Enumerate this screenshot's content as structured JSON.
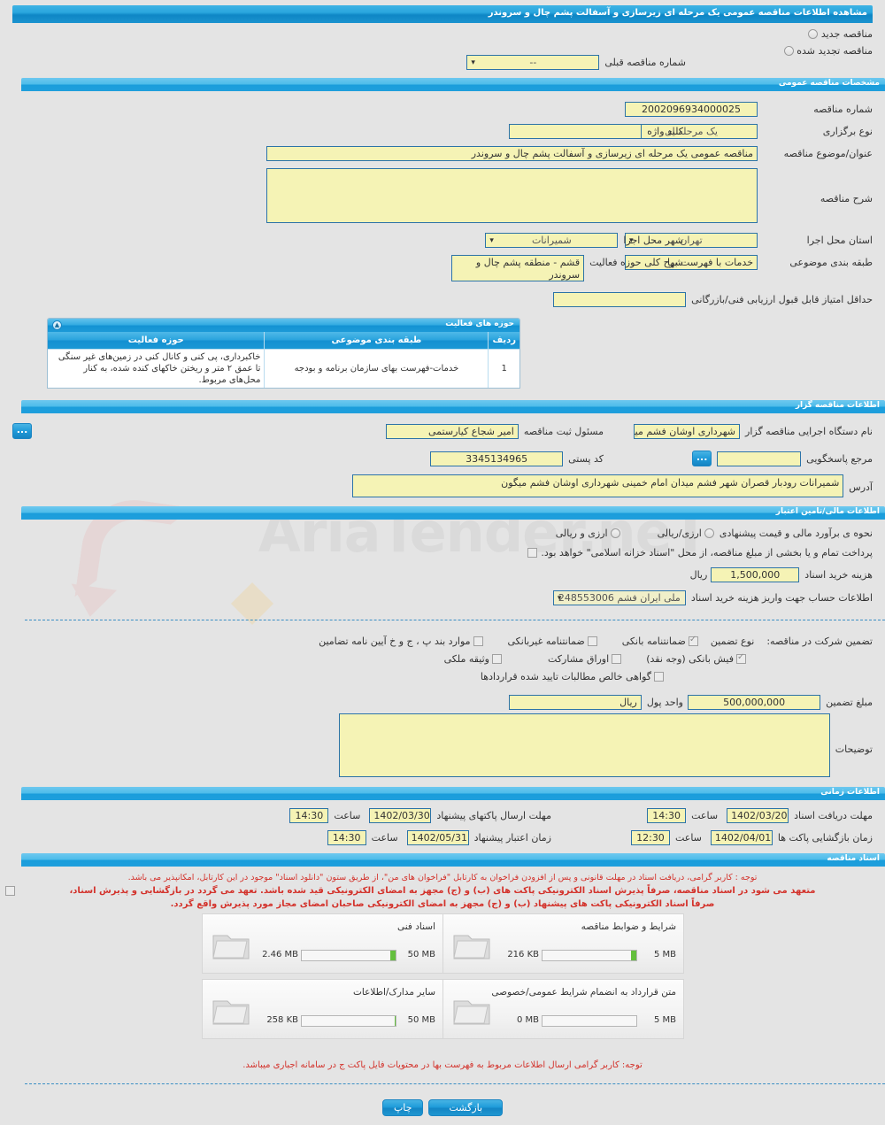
{
  "header": {
    "title": "مشاهده اطلاعات مناقصه عمومی یک مرحله ای زیرسازی و آسفالت پشم چال و سروندر"
  },
  "tender_type": {
    "new_label": "مناقصه جدید",
    "renewed_label": "مناقصه تجدید شده",
    "prev_number_label": "شماره مناقصه قبلی",
    "prev_number_value": "--"
  },
  "general": {
    "section_title": "مشخصات مناقصه عمومی",
    "tender_number_label": "شماره مناقصه",
    "tender_number_value": "2002096934000025",
    "holding_type_label": "نوع برگزاری",
    "holding_type_value": "یک مرحله ای",
    "keyword_label": "کلید واژه",
    "keyword_value": "",
    "subject_label": "عنوان/موضوع مناقصه",
    "subject_value": "مناقصه عمومی یک مرحله ای زیرسازی و آسفالت پشم چال و سروندر",
    "description_label": "شرح مناقصه",
    "description_value": "",
    "province_label": "استان محل اجرا",
    "province_value": "تهران",
    "city_label": "شهر محل اجرا",
    "city_value": "شمیرانات",
    "classification_label": "طبقه بندی موضوعی",
    "classification_value": "خدمات با فهرست بها",
    "activity_scope_label": "شرح کلی حوزه فعالیت",
    "activity_scope_value": "قشم - منطقه پشم چال و سروندر",
    "min_score_label": "حداقل امتیاز قابل قبول ارزیابی فنی/بازرگانی",
    "min_score_value": ""
  },
  "activity_table": {
    "section_title": "حوزه های فعالیت",
    "columns": [
      "ردیف",
      "طبقه بندی موضوعی",
      "حوزه فعالیت"
    ],
    "rows": [
      {
        "no": "1",
        "classification": "خدمات-فهرست بهای سازمان برنامه و بودجه",
        "scope": "خاکبرداری، پی کنی و کانال کنی در زمین‌های غیر سنگی تا عمق ۲ متر و ریختن خاکهای کنده شده، به کنار محل‌های مربوط."
      }
    ]
  },
  "organizer": {
    "section_title": "اطلاعات مناقصه گزار",
    "executive_org_label": "نام دستگاه اجرایی مناقصه گزار",
    "executive_org_value": "شهرداری اوشان فشم میگو",
    "registrar_label": "مسئول ثبت مناقصه",
    "registrar_value": "امیر شجاع کیارستمی",
    "answer_ref_label": "مرجع پاسخگویی",
    "answer_ref_value": "",
    "postal_code_label": "کد پستی",
    "postal_code_value": "3345134965",
    "address_label": "آدرس",
    "address_value": "شمیرانات رودبار قصران شهر فشم میدان امام خمینی شهرداری اوشان فشم میگون",
    "dots_label": "..."
  },
  "finance": {
    "section_title": "اطلاعات مالی/تامین اعتبار",
    "estimate_label": "نحوه ی برآورد مالی و قیمت پیشنهادی",
    "option_rial_label": "ارزی/ریالی",
    "option_forex_rial_label": "ارزی و ریالی",
    "treasury_note": "پرداخت تمام و یا بخشی از مبلغ مناقصه، از محل \"اسناد خزانه اسلامی\" خواهد بود.",
    "doc_cost_label": "هزینه خرید اسناد",
    "doc_cost_value": "1,500,000",
    "doc_cost_currency": "ریال",
    "account_label": "اطلاعات حساب جهت واریز هزینه خرید اسناد",
    "account_value": "ملی ایران فشم 248553006"
  },
  "guarantee": {
    "participation_label": "تضمین شرکت در مناقصه:",
    "type_label": "نوع تضمین",
    "options": [
      {
        "label": "ضمانتنامه بانکی",
        "checked": true
      },
      {
        "label": "ضمانتنامه غیربانکی",
        "checked": false
      },
      {
        "label": "موارد بند پ ، ج و خ آیین نامه تضامین",
        "checked": false
      },
      {
        "label": "فیش بانکی (وجه نقد)",
        "checked": true
      },
      {
        "label": "اوراق مشارکت",
        "checked": false
      },
      {
        "label": "وثیقه ملکی",
        "checked": false
      },
      {
        "label": "گواهی خالص مطالبات تایید شده قراردادها",
        "checked": false
      }
    ],
    "amount_label": "مبلغ تضمین",
    "amount_value": "500,000,000",
    "currency_label": "واحد پول",
    "currency_value": "ریال",
    "notes_label": "توضیحات",
    "notes_value": ""
  },
  "timing": {
    "section_title": "اطلاعات زمانی",
    "hour_label": "ساعت",
    "doc_receive_label": "مهلت دریافت اسناد",
    "doc_receive_date": "1402/03/20",
    "doc_receive_time": "14:30",
    "submit_label": "مهلت ارسال پاکتهای پیشنهاد",
    "submit_date": "1402/03/30",
    "submit_time": "14:30",
    "open_label": "زمان بازگشایی پاکت ها",
    "open_date": "1402/04/01",
    "open_time": "12:30",
    "validity_label": "زمان اعتبار پیشنهاد",
    "validity_date": "1402/05/31",
    "validity_time": "14:30"
  },
  "documents": {
    "section_title": "اسناد مناقصه",
    "notice1": "توجه : کاربر گرامی، دریافت اسناد در مهلت قانونی و پس از افزودن فراخوان به کارتابل \"فراخوان های من\"، از طریق ستون \"دانلود اسناد\" موجود در این کارتابل، امکانپذیر می باشد.",
    "notice2": "متعهد می شود در اسناد مناقصه، صرفاً پذیرش اسناد الکترونیکی پاکت های (ب) و (ج) مجهز به امضای الکترونیکی قید شده باشد. تعهد می گردد در بازگشایی و پذیرش اسناد،",
    "notice3": "صرفاً اسناد الکترونیکی پاکت های پیشنهاد (ب) و (ج) مجهز به امضای الکترونیکی صاحبان امضای مجاز مورد پذیرش واقع گردد.",
    "cards": [
      {
        "title": "شرایط و ضوابط مناقصه",
        "used": "216 KB",
        "max": "5 MB",
        "fill_pct": 6
      },
      {
        "title": "اسناد فنی",
        "used": "2.46 MB",
        "max": "50 MB",
        "fill_pct": 6
      },
      {
        "title": "متن قرارداد به انضمام شرایط عمومی/خصوصی",
        "used": "0 MB",
        "max": "5 MB",
        "fill_pct": 0
      },
      {
        "title": "سایر مدارک/اطلاعات",
        "used": "258 KB",
        "max": "50 MB",
        "fill_pct": 1
      }
    ],
    "bottom_notice": "توجه: کاربر گرامی ارسال اطلاعات مربوط به فهرست بها در محتویات فایل پاکت ج در سامانه اجباری میباشد."
  },
  "footer": {
    "print_label": "چاپ",
    "back_label": "بازگشت"
  },
  "watermark": {
    "text": "AriaTender.neT"
  }
}
